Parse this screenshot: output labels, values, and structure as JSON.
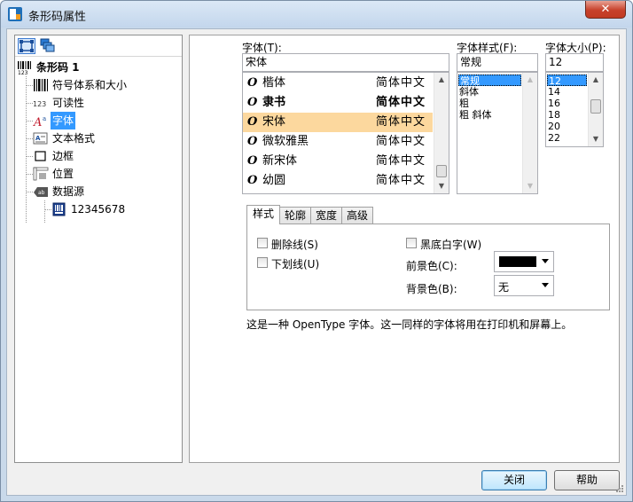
{
  "window": {
    "title": "条形码属性",
    "close_glyph": "✕"
  },
  "tree": {
    "root": "条形码 1",
    "items": [
      "符号体系和大小",
      "可读性",
      "字体",
      "文本格式",
      "边框",
      "位置",
      "数据源"
    ],
    "selected": "字体",
    "datasource_child": "12345678"
  },
  "font": {
    "label": "字体(T):",
    "value": "宋体",
    "list": [
      {
        "name": "楷体",
        "preview": "简体中文"
      },
      {
        "name": "隶书",
        "preview": "简体中文"
      },
      {
        "name": "宋体",
        "preview": "简体中文",
        "selected": true
      },
      {
        "name": "微软雅黑",
        "preview": "简体中文"
      },
      {
        "name": "新宋体",
        "preview": "简体中文"
      },
      {
        "name": "幼圆",
        "preview": "简体中文"
      }
    ]
  },
  "font_style": {
    "label": "字体样式(F):",
    "value": "常规",
    "list": [
      "常规",
      "斜体",
      "粗",
      "粗 斜体"
    ],
    "selected": "常规"
  },
  "font_size": {
    "label": "字体大小(P):",
    "value": "12",
    "list": [
      "12",
      "14",
      "16",
      "18",
      "20",
      "22"
    ],
    "selected": "12"
  },
  "tabs": [
    "样式",
    "轮廓",
    "宽度",
    "高级"
  ],
  "active_tab": "样式",
  "style_tab": {
    "strikethrough": "删除线(S)",
    "underline": "下划线(U)",
    "inverse": "黑底白字(W)",
    "foreground_label": "前景色(C):",
    "foreground_color": "#000000",
    "background_label": "背景色(B):",
    "background_value": "无"
  },
  "description": "这是一种 OpenType 字体。这一同样的字体将用在打印机和屏幕上。",
  "buttons": {
    "close": "关闭",
    "help": "帮助"
  },
  "colors": {
    "selection_blue": "#3399ff",
    "font_highlight": "#fcd89e",
    "title_bar": "#c9d9ea"
  }
}
